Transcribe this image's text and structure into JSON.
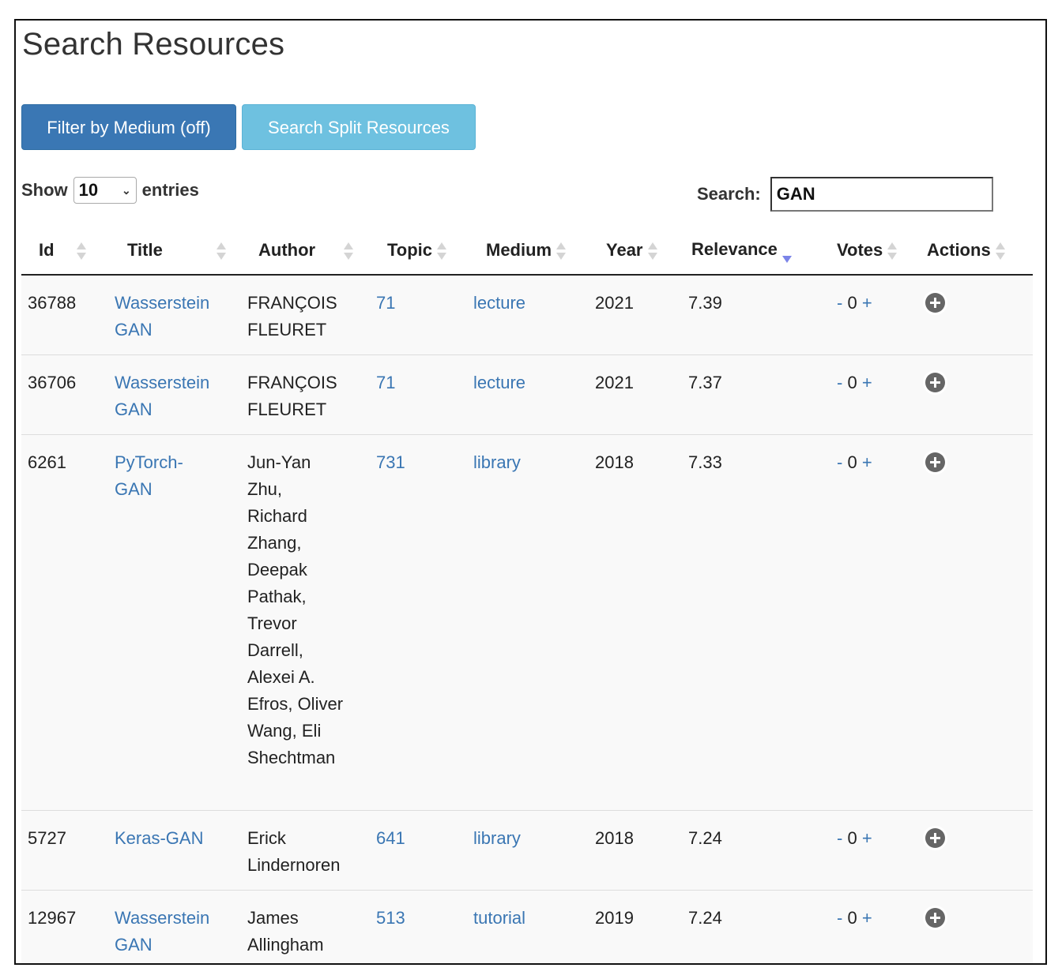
{
  "page": {
    "title": "Search Resources"
  },
  "toolbar": {
    "filter_label": "Filter by Medium (off)",
    "split_label": "Search Split Resources"
  },
  "length": {
    "show_label": "Show",
    "value": "10",
    "entries_label": "entries"
  },
  "search": {
    "label": "Search:",
    "value": "GAN"
  },
  "table": {
    "columns": [
      "Id",
      "Title",
      "Author",
      "Topic",
      "Medium",
      "Year",
      "Relevance",
      "Votes",
      "Actions"
    ],
    "sorted_column": "Relevance",
    "sort_direction": "descending",
    "rows": [
      {
        "id": "36788",
        "title": "Wasserstein GAN",
        "author": "FRANÇOIS FLEURET",
        "topic": "71",
        "medium": "lecture",
        "year": "2021",
        "relevance": "7.39",
        "minus": "-",
        "votes": "0",
        "plus": "+"
      },
      {
        "id": "36706",
        "title": "Wasserstein GAN",
        "author": "FRANÇOIS FLEURET",
        "topic": "71",
        "medium": "lecture",
        "year": "2021",
        "relevance": "7.37",
        "minus": "-",
        "votes": "0",
        "plus": "+"
      },
      {
        "id": "6261",
        "title": "PyTorch-GAN",
        "author": "Jun-Yan Zhu, Richard Zhang, Deepak Pathak, Trevor Darrell, Alexei A. Efros, Oliver Wang, Eli Shechtman",
        "topic": "731",
        "medium": "library",
        "year": "2018",
        "relevance": "7.33",
        "minus": "-",
        "votes": "0",
        "plus": "+"
      },
      {
        "id": "5727",
        "title": "Keras-GAN",
        "author": "Erick Lindernoren",
        "topic": "641",
        "medium": "library",
        "year": "2018",
        "relevance": "7.24",
        "minus": "-",
        "votes": "0",
        "plus": "+"
      },
      {
        "id": "12967",
        "title": "Wasserstein GAN",
        "author": "James Allingham",
        "topic": "513",
        "medium": "tutorial",
        "year": "2019",
        "relevance": "7.24",
        "minus": "-",
        "votes": "0",
        "plus": "+"
      }
    ]
  },
  "icons": {
    "sort": "sort-both-icon",
    "sort_desc": "sort-desc-icon",
    "add": "plus-circle-icon",
    "select": "chevron-down-icon"
  },
  "colors": {
    "primary_button": "#3a77b4",
    "info_button": "#6ec1e0",
    "link": "#3a76b3",
    "sort_active": "#7b84e8"
  }
}
